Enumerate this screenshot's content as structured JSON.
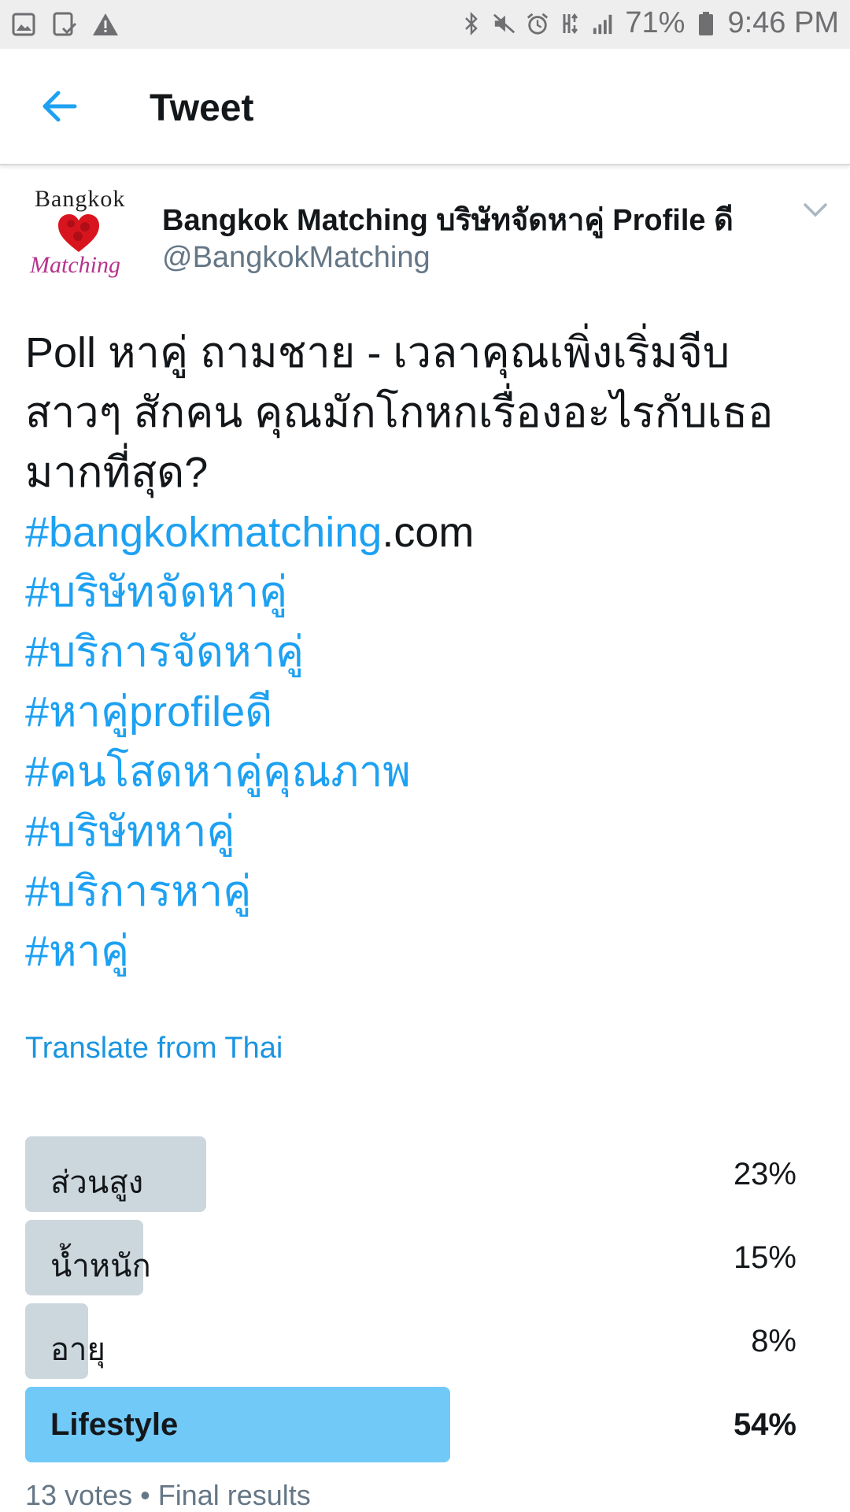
{
  "status_bar": {
    "left_icons": [
      "image-icon",
      "tablet-check-icon",
      "warning-icon"
    ],
    "right_icons": [
      "bluetooth-icon",
      "mute-icon",
      "alarm-icon",
      "data-icon",
      "signal-icon"
    ],
    "battery": "71%",
    "time": "9:46 PM"
  },
  "app_bar": {
    "title": "Tweet",
    "back_icon": "arrow-left-icon",
    "accent": "#1da1f2"
  },
  "tweet": {
    "avatar": {
      "top_text": "Bangkok",
      "bottom_text": "Matching"
    },
    "author_name": "Bangkok Matching บริษัทจัดหาคู่ Profile ดี",
    "handle": "@BangkokMatching",
    "lines": [
      "Poll หาคู่ ถามชาย - เวลาคุณเพิ่งเริ่มจีบ",
      "สาวๆ สักคน  คุณมักโกหกเรื่องอะไรกับเธอ",
      "มากที่สุด?"
    ],
    "link_hashtag": "#bangkokmatching",
    "link_suffix": ".com",
    "hashtags": [
      "#บริษัทจัดหาคู่",
      "#บริการจัดหาคู่",
      "#หาคู่profileดี",
      "#คนโสดหาคู่คุณภาพ",
      "#บริษัทหาคู่",
      "#บริการหาคู่",
      "#หาคู่"
    ],
    "translate_label": "Translate from Thai"
  },
  "poll": {
    "options": [
      {
        "label": "ส่วนสูง",
        "percent": "23%",
        "fraction": 0.23,
        "winner": false
      },
      {
        "label": "น้ำหนัก",
        "percent": "15%",
        "fraction": 0.15,
        "winner": false
      },
      {
        "label": "อายุ",
        "percent": "8%",
        "fraction": 0.08,
        "winner": false
      },
      {
        "label": "Lifestyle",
        "percent": "54%",
        "fraction": 0.54,
        "winner": true
      }
    ],
    "footer": "13 votes • Final results",
    "colors": {
      "bar": "#ccd6dd",
      "winner_bar": "#71c9f8"
    }
  }
}
